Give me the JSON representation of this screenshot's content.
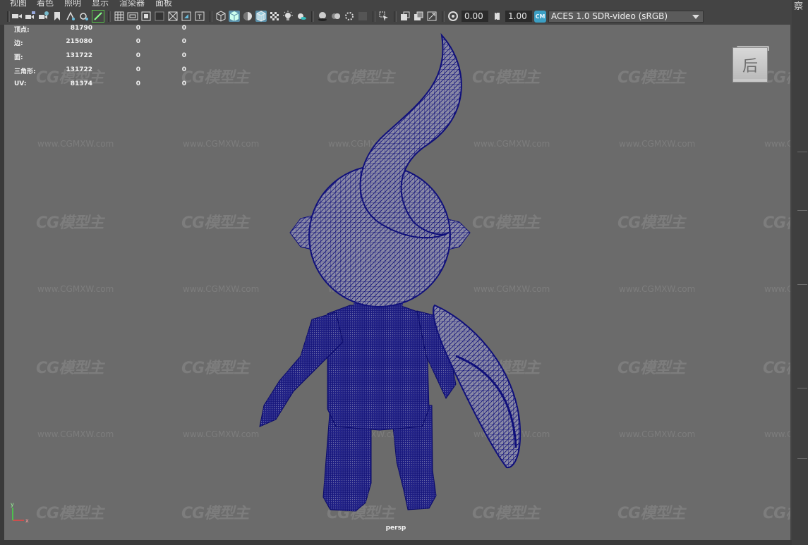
{
  "menu": [
    "视图",
    "着色",
    "照明",
    "显示",
    "渲染器",
    "面板"
  ],
  "toolbar": {
    "exposure_value": "0.00",
    "gamma_value": "1.00",
    "colorspace_badge": "CM",
    "colorspace": "ACES 1.0 SDR-video (sRGB)",
    "icons": [
      "camera-select-icon",
      "camera-attributes-icon",
      "bookmark-icon",
      "image-plane-icon",
      "grid-icon",
      "film-gate-icon",
      "resolution-gate-icon",
      "gate-mask-icon",
      "field-chart-icon",
      "safe-action-icon",
      "safe-title-icon",
      "wireframe-icon",
      "smooth-shade-icon",
      "default-material-icon",
      "wireframe-on-shaded-icon",
      "textured-icon",
      "lights-icon",
      "shadows-icon",
      "screen-space-ao-icon",
      "motion-blur-icon",
      "anti-aliasing-icon",
      "depth-of-field-icon",
      "isolate-select-icon",
      "xray-icon",
      "xray-joints-icon",
      "backface-culling-icon",
      "exposure-icon",
      "gamma-icon"
    ]
  },
  "hud": {
    "rows": [
      {
        "label": "顶点:",
        "values": [
          "81790",
          "0",
          "0"
        ]
      },
      {
        "label": "边:",
        "values": [
          "215080",
          "0",
          "0"
        ]
      },
      {
        "label": "面:",
        "values": [
          "131722",
          "0",
          "0"
        ]
      },
      {
        "label": "三角形:",
        "values": [
          "131722",
          "0",
          "0"
        ]
      },
      {
        "label": "UV:",
        "values": [
          "81374",
          "0",
          "0"
        ]
      }
    ]
  },
  "viewcube_face": "后",
  "camera": "persp",
  "axis": {
    "x": "x",
    "y": "y"
  },
  "right_panel_text": "察",
  "watermark": {
    "logo": "CG模型主",
    "url": "www.CGMXW.com"
  },
  "colors": {
    "viewport_bg": "#6b6b6b",
    "ui_bg": "#444444",
    "wire_color": "#10107a",
    "mesh_fill": "#8a8aa6",
    "active_icon": "#5a8fa8"
  }
}
